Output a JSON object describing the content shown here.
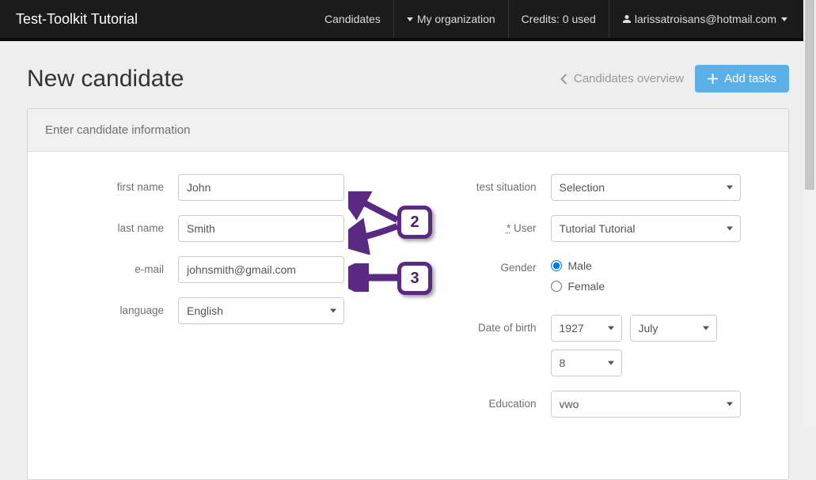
{
  "navbar": {
    "brand": "Test-Toolkit Tutorial",
    "items": {
      "candidates": "Candidates",
      "my_org": "My organization",
      "credits": "Credits: 0 used",
      "user": "larissatroisans@hotmail.com"
    }
  },
  "header": {
    "title": "New candidate",
    "overview_link": "Candidates overview",
    "add_tasks": "Add tasks"
  },
  "panel": {
    "heading": "Enter candidate information"
  },
  "form": {
    "labels": {
      "first_name": "first name",
      "last_name": "last name",
      "email": "e-mail",
      "language": "language",
      "test_situation": "test situation",
      "user": "User",
      "user_prefix": "*",
      "gender": "Gender",
      "dob": "Date of birth",
      "education": "Education"
    },
    "values": {
      "first_name": "John",
      "last_name": "Smith",
      "email": "johnsmith@gmail.com",
      "language": "English",
      "test_situation": "Selection",
      "user": "Tutorial Tutorial",
      "gender_male": "Male",
      "gender_female": "Female",
      "gender_selected": "male",
      "dob_year": "1927",
      "dob_month": "July",
      "dob_day": "8",
      "education": "vwo"
    }
  },
  "annotations": {
    "step2": "2",
    "step3": "3"
  }
}
